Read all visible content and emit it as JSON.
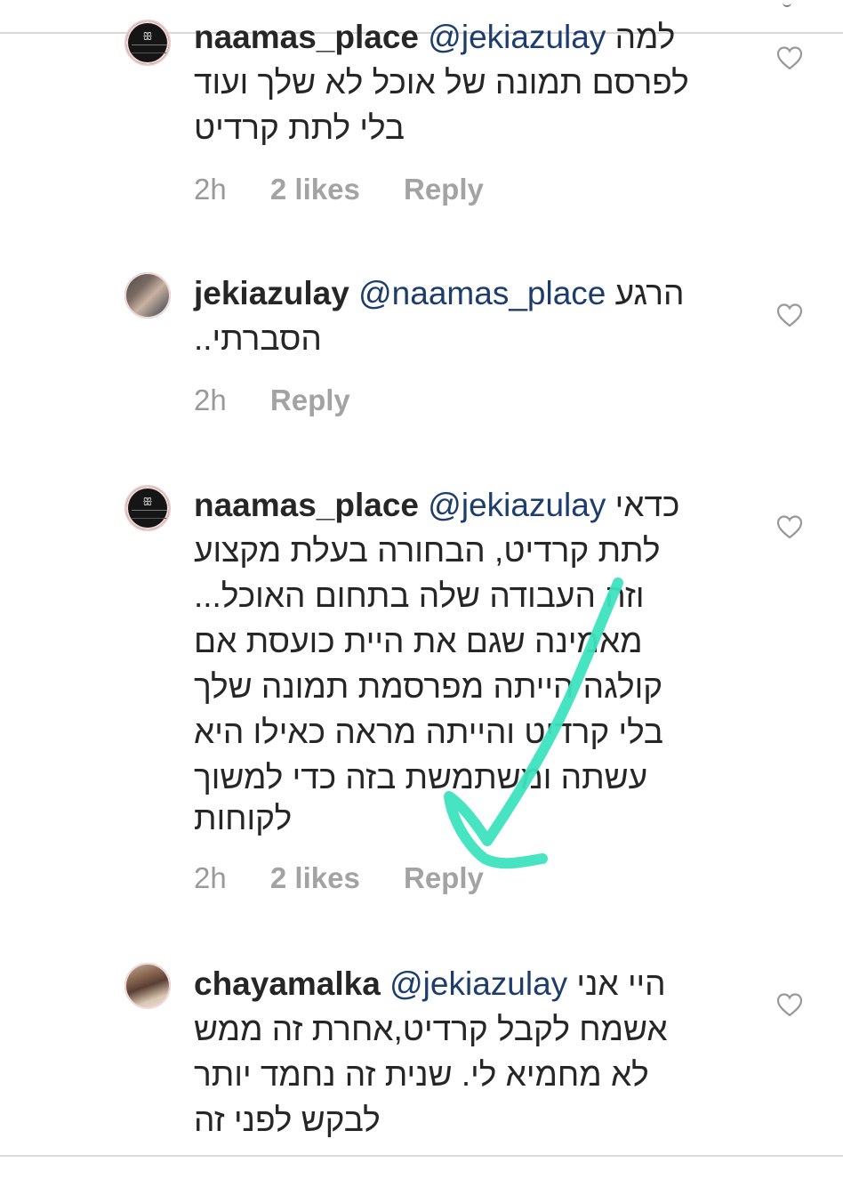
{
  "comments": [
    {
      "username": "naamas_place",
      "mention": "@jekiazulay",
      "first_line_text": "למה",
      "lines": [
        "לפרסם תמונה של אוכל לא שלך ועוד",
        "בלי לתת קרדיט"
      ],
      "time": "2h",
      "likes": "2 likes",
      "reply": "Reply"
    },
    {
      "username": "jekiazulay",
      "mention": "@naamas_place",
      "first_line_text": "הרגע",
      "lines": [
        "הסברתי.."
      ],
      "time": "2h",
      "reply": "Reply"
    },
    {
      "username": "naamas_place",
      "mention": "@jekiazulay",
      "first_line_text": "כדאי",
      "lines": [
        "לתת קרדיט, הבחורה בעלת מקצוע",
        "וזה העבודה שלה בתחום האוכל...",
        "מאמינה שגם את היית כועסת אם",
        "קולגה הייתה מפרסמת תמונה שלך",
        "בלי קרדיט והייתה מראה כאילו היא",
        "עשתה ומשתמשת בזה כדי למשוך",
        "לקוחות"
      ],
      "time": "2h",
      "likes": "2 likes",
      "reply": "Reply"
    },
    {
      "username": "chayamalka",
      "mention": "@jekiazulay",
      "first_line_text": "היי אני",
      "lines": [
        "אשמח לקבל קרדיט,אחרת זה ממש",
        "לא מחמיא לי. שנית זה נחמד יותר",
        "לבקש לפני זה"
      ]
    }
  ],
  "icons": {
    "heart": "heart-outline-icon",
    "logo": "naamas-place-logo",
    "annotation": "checkmark-annotation"
  },
  "colors": {
    "text": "#262626",
    "mention": "#1d3d6d",
    "meta": "#9a9a9a",
    "check": "#3de3bf"
  }
}
